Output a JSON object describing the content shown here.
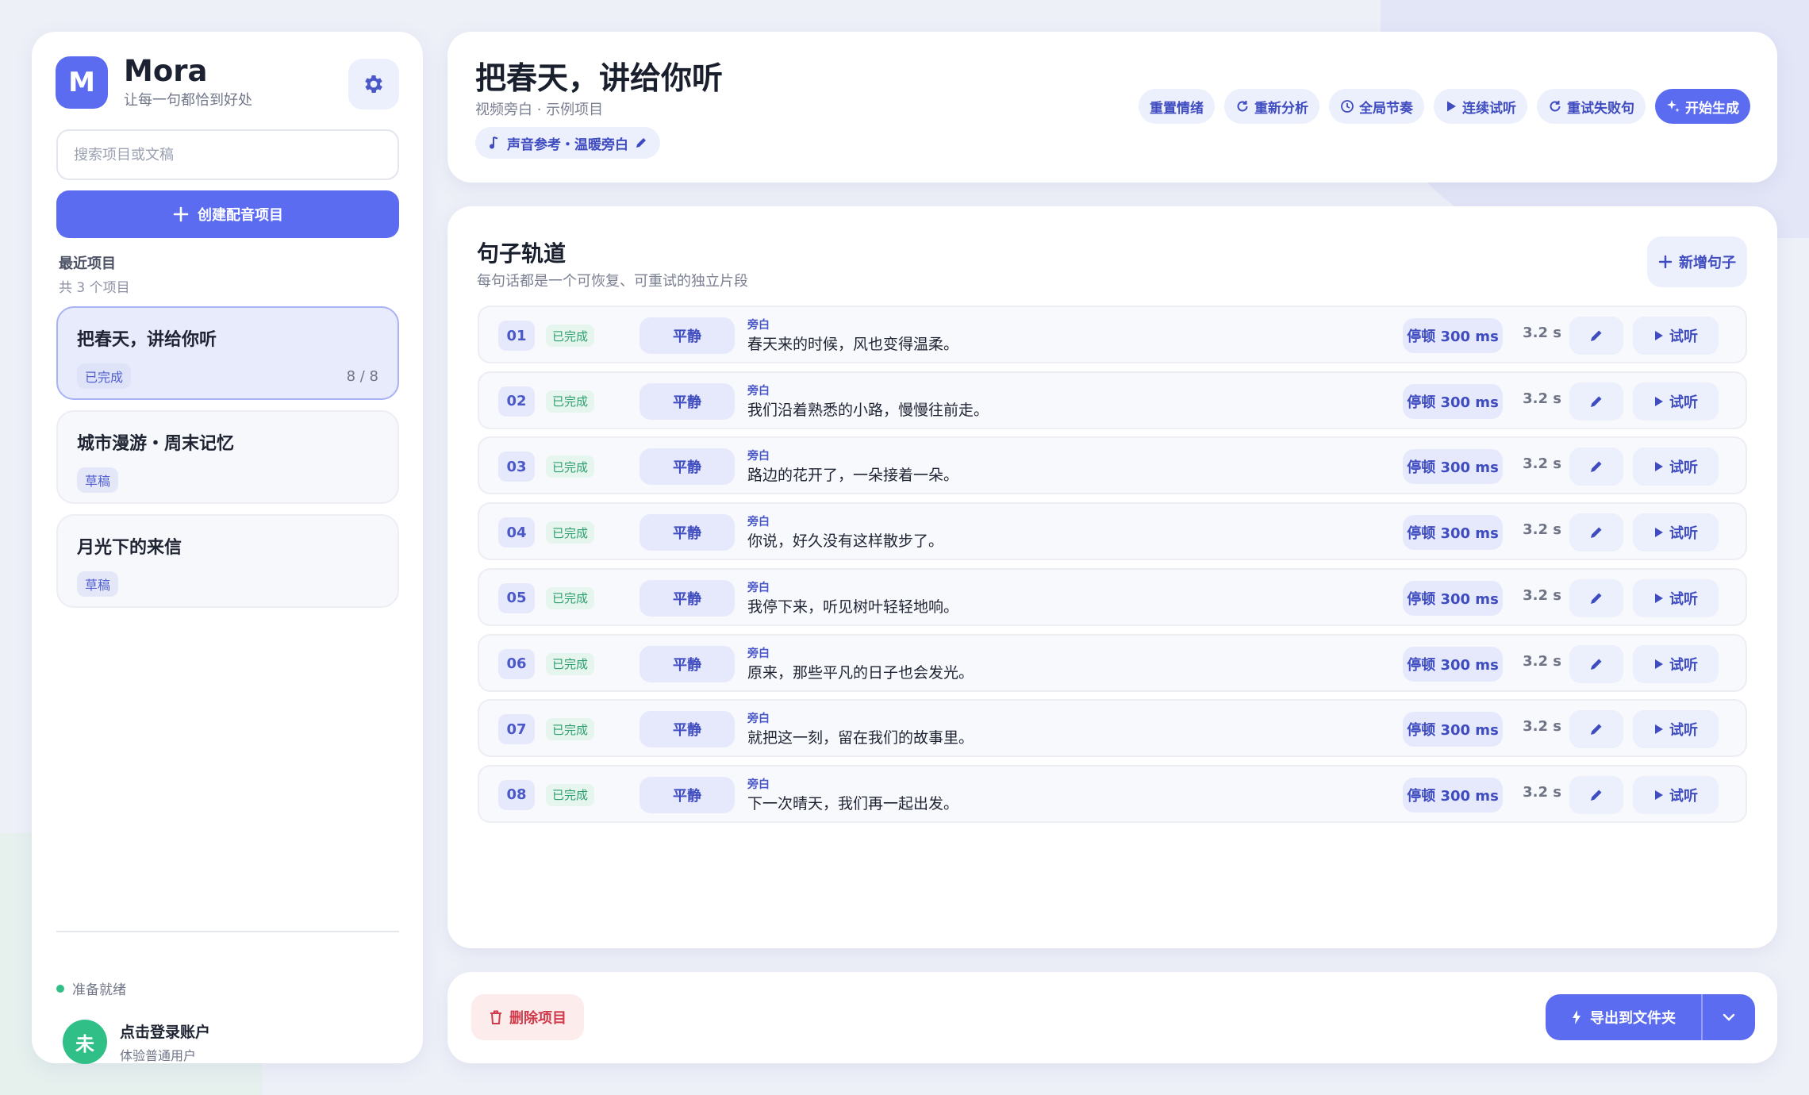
{
  "brand": {
    "logo_letter": "M",
    "name": "Mora",
    "tagline": "让每一句都恰到好处"
  },
  "sidebar": {
    "search_placeholder": "搜索项目或文稿",
    "create_label": "创建配音项目",
    "recent_title": "最近项目",
    "recent_count": "共 3 个项目",
    "projects": [
      {
        "name": "把春天，讲给你听",
        "status": "已完成",
        "progress": "8 / 8",
        "active": true
      },
      {
        "name": "城市漫游・周末记忆",
        "status": "草稿",
        "progress": ""
      },
      {
        "name": "月光下的来信",
        "status": "草稿",
        "progress": ""
      }
    ],
    "status_text": "准备就绪",
    "user": {
      "avatar_letter": "未",
      "name": "点击登录账户",
      "tier": "体验普通用户"
    }
  },
  "header": {
    "title": "把春天，讲给你听",
    "subtitle": "视频旁白 · 示例项目",
    "voice_ref": "声音参考・温暖旁白",
    "actions": {
      "reset_emotion": "重置情绪",
      "reanalyze": "重新分析",
      "global_rhythm": "全局节奏",
      "continuous_listen": "连续试听",
      "retry_failed": "重试失败句",
      "start_generate": "开始生成"
    }
  },
  "track": {
    "title": "句子轨道",
    "subtitle": "每句话都是一个可恢复、可重试的独立片段",
    "add_label": "新增句子",
    "rows": [
      {
        "num": "01",
        "status": "已完成",
        "emotion": "平静",
        "speaker": "旁白",
        "text": "春天来的时候，风也变得温柔。",
        "pause": "停顿 300 ms",
        "duration": "3.2 s",
        "listen": "试听"
      },
      {
        "num": "02",
        "status": "已完成",
        "emotion": "平静",
        "speaker": "旁白",
        "text": "我们沿着熟悉的小路，慢慢往前走。",
        "pause": "停顿 300 ms",
        "duration": "3.2 s",
        "listen": "试听"
      },
      {
        "num": "03",
        "status": "已完成",
        "emotion": "平静",
        "speaker": "旁白",
        "text": "路边的花开了，一朵接着一朵。",
        "pause": "停顿 300 ms",
        "duration": "3.2 s",
        "listen": "试听"
      },
      {
        "num": "04",
        "status": "已完成",
        "emotion": "平静",
        "speaker": "旁白",
        "text": "你说，好久没有这样散步了。",
        "pause": "停顿 300 ms",
        "duration": "3.2 s",
        "listen": "试听"
      },
      {
        "num": "05",
        "status": "已完成",
        "emotion": "平静",
        "speaker": "旁白",
        "text": "我停下来，听见树叶轻轻地响。",
        "pause": "停顿 300 ms",
        "duration": "3.2 s",
        "listen": "试听"
      },
      {
        "num": "06",
        "status": "已完成",
        "emotion": "平静",
        "speaker": "旁白",
        "text": "原来，那些平凡的日子也会发光。",
        "pause": "停顿 300 ms",
        "duration": "3.2 s",
        "listen": "试听"
      },
      {
        "num": "07",
        "status": "已完成",
        "emotion": "平静",
        "speaker": "旁白",
        "text": "就把这一刻，留在我们的故事里。",
        "pause": "停顿 300 ms",
        "duration": "3.2 s",
        "listen": "试听"
      },
      {
        "num": "08",
        "status": "已完成",
        "emotion": "平静",
        "speaker": "旁白",
        "text": "下一次晴天，我们再一起出发。",
        "pause": "停顿 300 ms",
        "duration": "3.2 s",
        "listen": "试听"
      }
    ]
  },
  "footer": {
    "delete_label": "删除项目",
    "export_label": "导出到文件夹"
  },
  "colors": {
    "accent": "#5b6cf0",
    "success": "#2fbf87",
    "danger": "#d0394a"
  },
  "icons": [
    "gear-icon",
    "plus-icon",
    "music-note-icon",
    "pencil-icon",
    "refresh-icon",
    "clock-icon",
    "play-icon",
    "sparkle-icon",
    "trash-icon",
    "bolt-icon",
    "chevron-down-icon"
  ]
}
